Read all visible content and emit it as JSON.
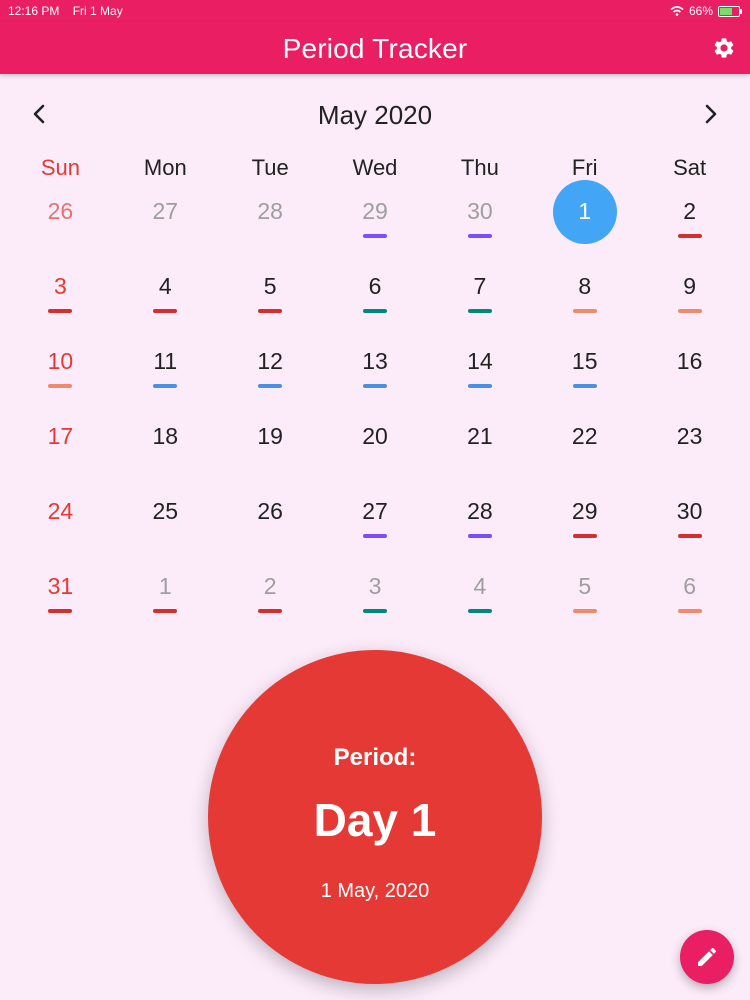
{
  "status": {
    "time": "12:16 PM",
    "date": "Fri 1 May",
    "battery": "66%"
  },
  "app": {
    "title": "Period Tracker"
  },
  "calendar": {
    "month": "May 2020",
    "weekdays": [
      "Sun",
      "Mon",
      "Tue",
      "Wed",
      "Thu",
      "Fri",
      "Sat"
    ],
    "colors": {
      "red": "#d32f2f",
      "green": "#00897b",
      "orange": "#ef8a6a",
      "blue": "#4a90e2",
      "purple": "#7c4dff",
      "selected": "#42a5f5"
    },
    "weeks": [
      [
        {
          "day": "26",
          "other": true
        },
        {
          "day": "27",
          "other": true
        },
        {
          "day": "28",
          "other": true
        },
        {
          "day": "29",
          "other": true,
          "mark": "purple"
        },
        {
          "day": "30",
          "other": true,
          "mark": "purple"
        },
        {
          "day": "1",
          "selected": true,
          "mark": "red"
        },
        {
          "day": "2",
          "mark": "red"
        }
      ],
      [
        {
          "day": "3",
          "mark": "red"
        },
        {
          "day": "4",
          "mark": "red"
        },
        {
          "day": "5",
          "mark": "red"
        },
        {
          "day": "6",
          "mark": "green"
        },
        {
          "day": "7",
          "mark": "green"
        },
        {
          "day": "8",
          "mark": "orange"
        },
        {
          "day": "9",
          "mark": "orange"
        }
      ],
      [
        {
          "day": "10",
          "mark": "orange"
        },
        {
          "day": "11",
          "mark": "blue"
        },
        {
          "day": "12",
          "mark": "blue"
        },
        {
          "day": "13",
          "mark": "blue"
        },
        {
          "day": "14",
          "mark": "blue"
        },
        {
          "day": "15",
          "mark": "blue"
        },
        {
          "day": "16"
        }
      ],
      [
        {
          "day": "17"
        },
        {
          "day": "18"
        },
        {
          "day": "19"
        },
        {
          "day": "20"
        },
        {
          "day": "21"
        },
        {
          "day": "22"
        },
        {
          "day": "23"
        }
      ],
      [
        {
          "day": "24"
        },
        {
          "day": "25"
        },
        {
          "day": "26"
        },
        {
          "day": "27",
          "mark": "purple"
        },
        {
          "day": "28",
          "mark": "purple"
        },
        {
          "day": "29",
          "mark": "red"
        },
        {
          "day": "30",
          "mark": "red"
        }
      ],
      [
        {
          "day": "31",
          "mark": "red"
        },
        {
          "day": "1",
          "other": true,
          "mark": "red"
        },
        {
          "day": "2",
          "other": true,
          "mark": "red"
        },
        {
          "day": "3",
          "other": true,
          "mark": "green"
        },
        {
          "day": "4",
          "other": true,
          "mark": "green"
        },
        {
          "day": "5",
          "other": true,
          "mark": "orange"
        },
        {
          "day": "6",
          "other": true,
          "mark": "orange"
        }
      ]
    ]
  },
  "status_circle": {
    "label": "Period:",
    "value": "Day 1",
    "date": "1 May, 2020",
    "color": "#e53935"
  },
  "icons": {
    "settings": "gear-icon",
    "prev": "chevron-left-icon",
    "next": "chevron-right-icon",
    "edit": "pencil-icon"
  }
}
